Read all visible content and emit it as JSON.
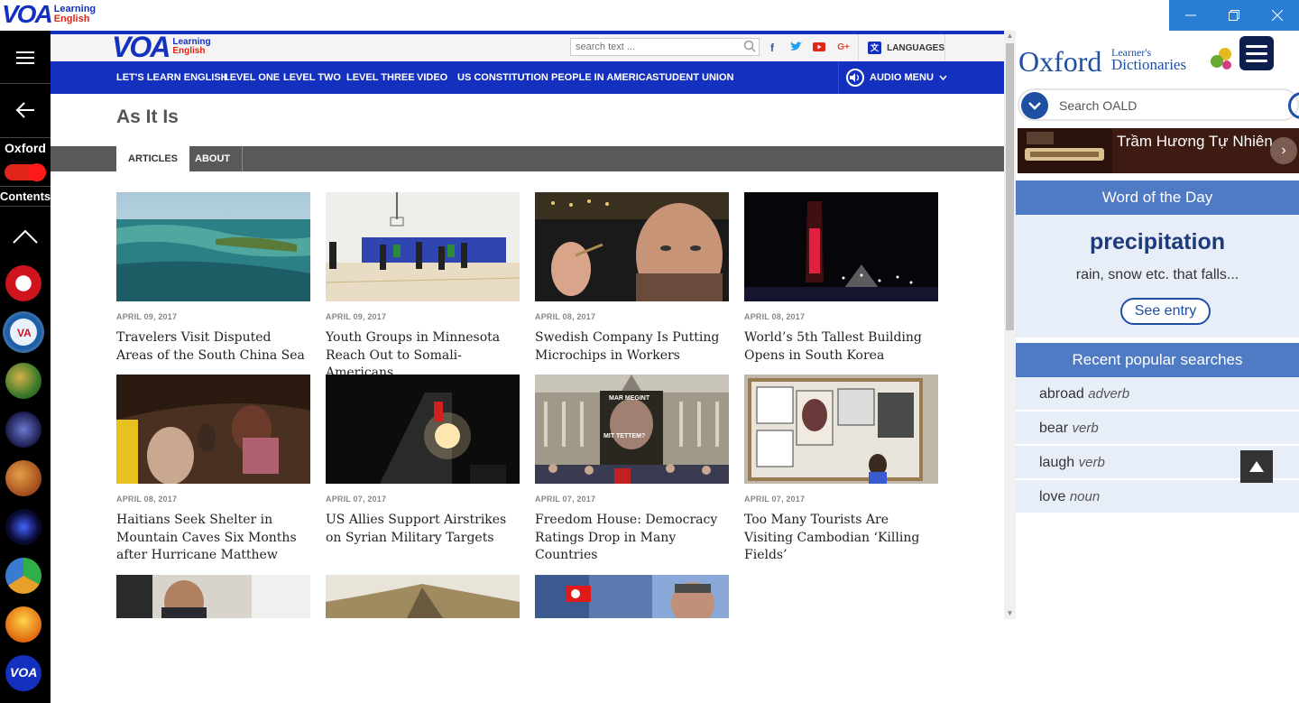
{
  "app": {
    "logo_line1": "Learning",
    "logo_line2": "English",
    "window_controls": [
      "minimize-icon",
      "restore-icon",
      "close-icon"
    ]
  },
  "sidebar": {
    "oxford_label": "Oxford",
    "oxford_toggle_on": true,
    "contents_label": "Contents",
    "app_icons": [
      "voa-icon",
      "voa-world-icon",
      "nature-icon",
      "science-icon",
      "planet-icon",
      "galaxy-icon",
      "learn-icon",
      "sunset-icon",
      "voa-news-icon"
    ]
  },
  "site": {
    "logo_line1": "Learning",
    "logo_line2": "English",
    "search_placeholder": "search text ...",
    "social": [
      "f",
      "t",
      "yt",
      "G+"
    ],
    "languages_label": "LANGUAGES",
    "nav": [
      "LET'S LEARN ENGLISH",
      "LEVEL ONE",
      "LEVEL TWO",
      "LEVEL THREE",
      "VIDEO",
      "US CONSTITUTION",
      "PEOPLE IN AMERICA",
      "STUDENT UNION"
    ],
    "audio_menu": "AUDIO MENU",
    "page_title": "As It Is",
    "tabs": [
      "ARTICLES",
      "ABOUT"
    ],
    "articles": [
      {
        "date": "APRIL 09, 2017",
        "headline": "Travelers Visit Disputed Areas of the South China Sea"
      },
      {
        "date": "APRIL 09, 2017",
        "headline": "Youth Groups in Minnesota Reach Out to Somali-Americans"
      },
      {
        "date": "APRIL 08, 2017",
        "headline": "Swedish Company Is Putting Microchips in Workers"
      },
      {
        "date": "APRIL 08, 2017",
        "headline": "World’s 5th Tallest Building Opens in South Korea"
      },
      {
        "date": "APRIL 08, 2017",
        "headline": "Haitians Seek Shelter in Mountain Caves Six Months after Hurricane Matthew"
      },
      {
        "date": "APRIL 07, 2017",
        "headline": "US Allies Support Airstrikes on Syrian Military Targets"
      },
      {
        "date": "APRIL 07, 2017",
        "headline": "Freedom House: Democracy Ratings Drop in Many Countries"
      },
      {
        "date": "APRIL 07, 2017",
        "headline": "Too Many Tourists Are Visiting Cambodian ‘Killing Fields’"
      }
    ],
    "poster_text_1": "MAR MEGINT",
    "poster_text_2": "MIT TETTEM?"
  },
  "oxford": {
    "title": "Oxford",
    "subtitle_line1": "Learner's",
    "subtitle_line2": "Dictionaries",
    "search_placeholder": "Search OALD",
    "ad_text": "Trầm Hương Tự Nhiên",
    "wotd_header": "Word of the Day",
    "wotd_word": "precipitation",
    "wotd_def": "rain, snow etc. that falls...",
    "see_entry": "See entry",
    "recent_header": "Recent popular searches",
    "recent": [
      {
        "word": "abroad",
        "pos": "adverb"
      },
      {
        "word": "bear",
        "pos": "verb"
      },
      {
        "word": "laugh",
        "pos": "verb"
      },
      {
        "word": "love",
        "pos": "noun"
      }
    ]
  },
  "colors": {
    "voa_blue": "#1330bf",
    "oxford_blue": "#4f7ac4",
    "toggle_red": "#e0261b"
  }
}
